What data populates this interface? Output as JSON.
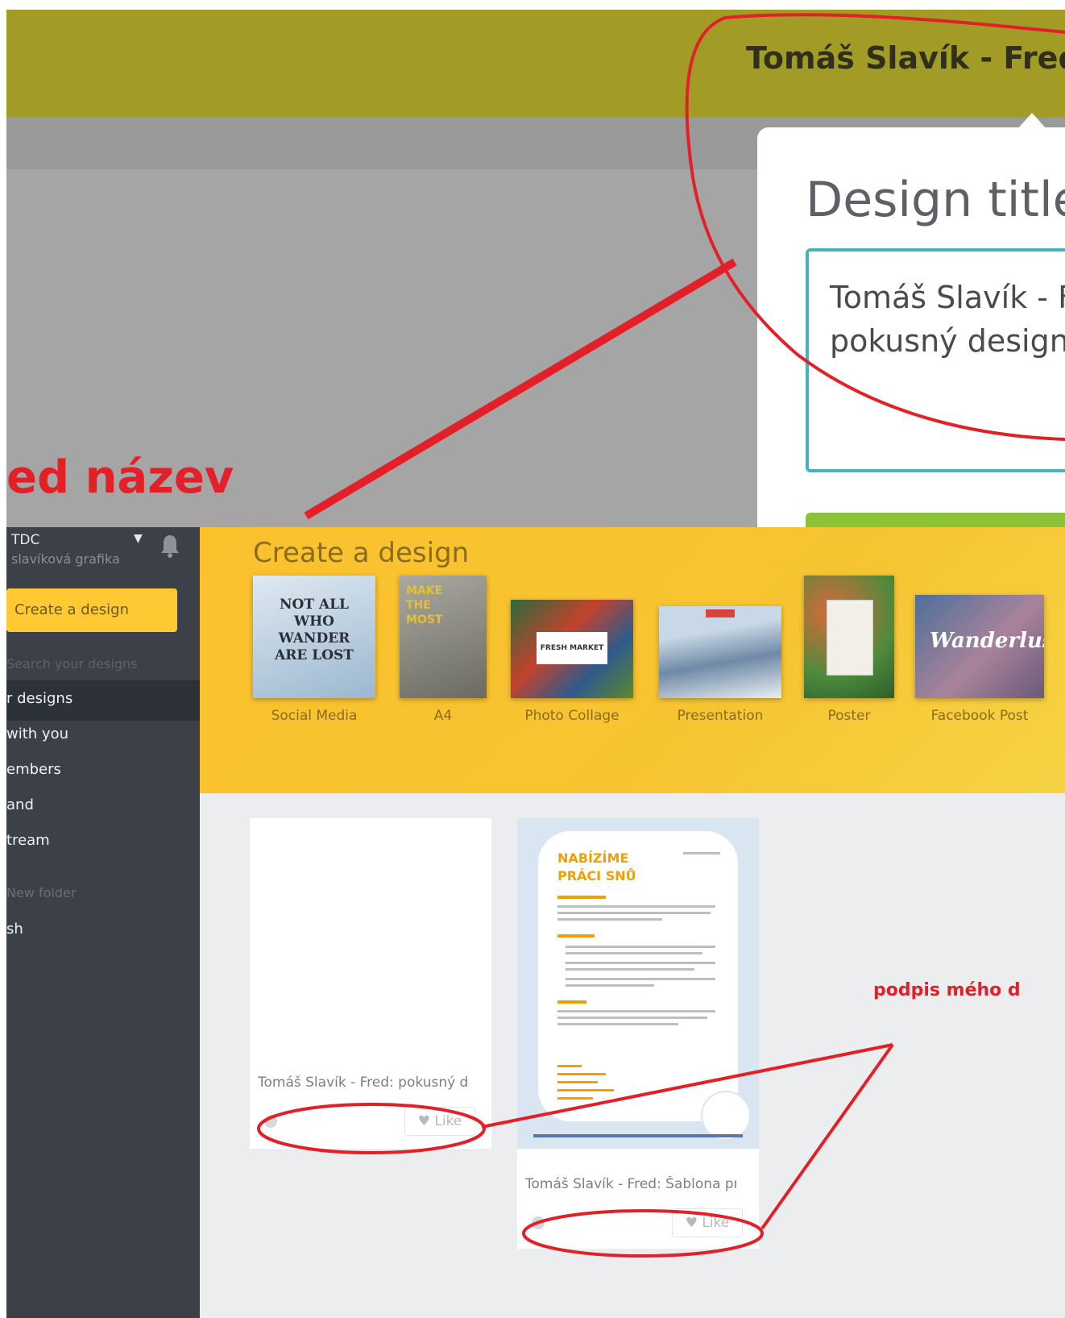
{
  "top": {
    "doc_title": "Tomáš Slavík - Fred:",
    "popup_heading": "Design title",
    "popup_input_value": "Tomáš Slavík - Fr\npokusný design",
    "annotation_text": "ed název"
  },
  "sidebar": {
    "team_name": "TDC",
    "team_subtitle": "slavíková grafika",
    "create_button": "Create a design",
    "search_label": "Search your designs",
    "items": [
      {
        "label": "r designs"
      },
      {
        "label": " with you"
      },
      {
        "label": "embers"
      },
      {
        "label": "and"
      },
      {
        "label": "tream"
      }
    ],
    "new_folder": "New folder",
    "trash": "sh"
  },
  "create": {
    "title": "Create a design",
    "templates": [
      {
        "label": "Social Media",
        "thumb_text": "NOT ALL WHO WANDER ARE LOST"
      },
      {
        "label": "A4",
        "thumb_text": "MAKE THE MOST"
      },
      {
        "label": "Photo Collage",
        "thumb_text": "FRESH MARKET"
      },
      {
        "label": "Presentation",
        "thumb_text": ""
      },
      {
        "label": "Poster",
        "thumb_text": ""
      },
      {
        "label": "Facebook Post",
        "thumb_text": "Wanderlust"
      }
    ]
  },
  "designs": [
    {
      "caption": "Tomáš Slavík - Fred: pokusný de...",
      "like": "Like"
    },
    {
      "caption": "Tomáš Slavík - Fred: Šablona pro...",
      "like": "Like",
      "flyer_title_1": "NABÍZÍME",
      "flyer_title_2": "PRÁCI SNŮ"
    }
  ],
  "annotation_2": "podpis mého d",
  "colors": {
    "accent_yellow": "#fbc12d",
    "sidebar": "#3c4149",
    "topbar": "#a29c26",
    "annotation_red": "#e32027",
    "input_border": "#46b3bb",
    "button_green": "#8cc236"
  }
}
